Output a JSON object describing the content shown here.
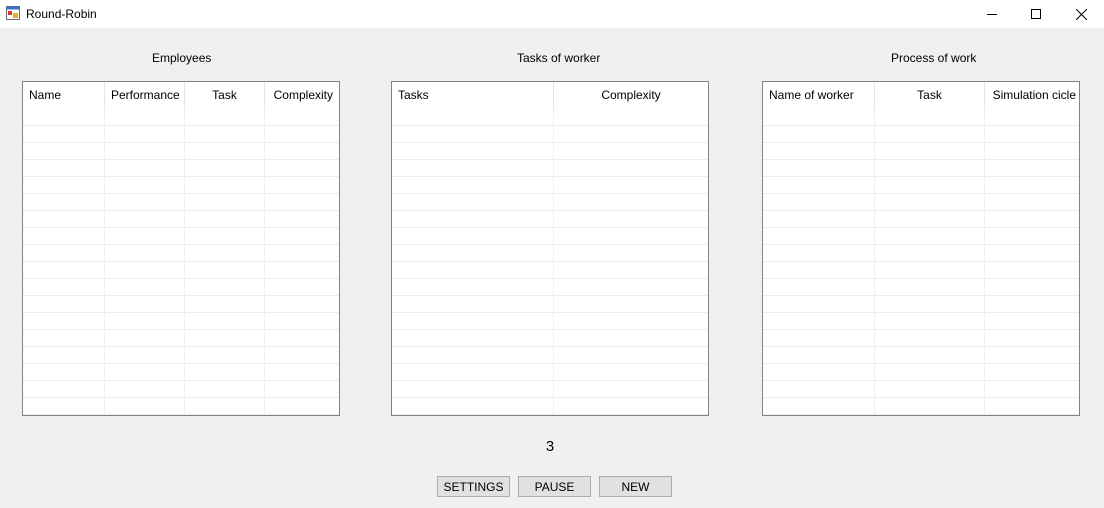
{
  "window": {
    "title": "Round-Robin",
    "controls": [
      "minimize-icon",
      "maximize-icon",
      "close-icon"
    ]
  },
  "employees": {
    "title": "Employees",
    "columns": [
      "Name",
      "Performance",
      "Task",
      "Complexity"
    ]
  },
  "tasks_of_worker": {
    "title": "Tasks of worker",
    "columns": [
      "Tasks",
      "Complexity"
    ]
  },
  "process_of_work": {
    "title": "Process of work",
    "columns": [
      "Name of worker",
      "Task",
      "Simulation cicle"
    ]
  },
  "counter": "3",
  "buttons": {
    "settings": "SETTINGS",
    "pause": "PAUSE",
    "new": "NEW"
  }
}
